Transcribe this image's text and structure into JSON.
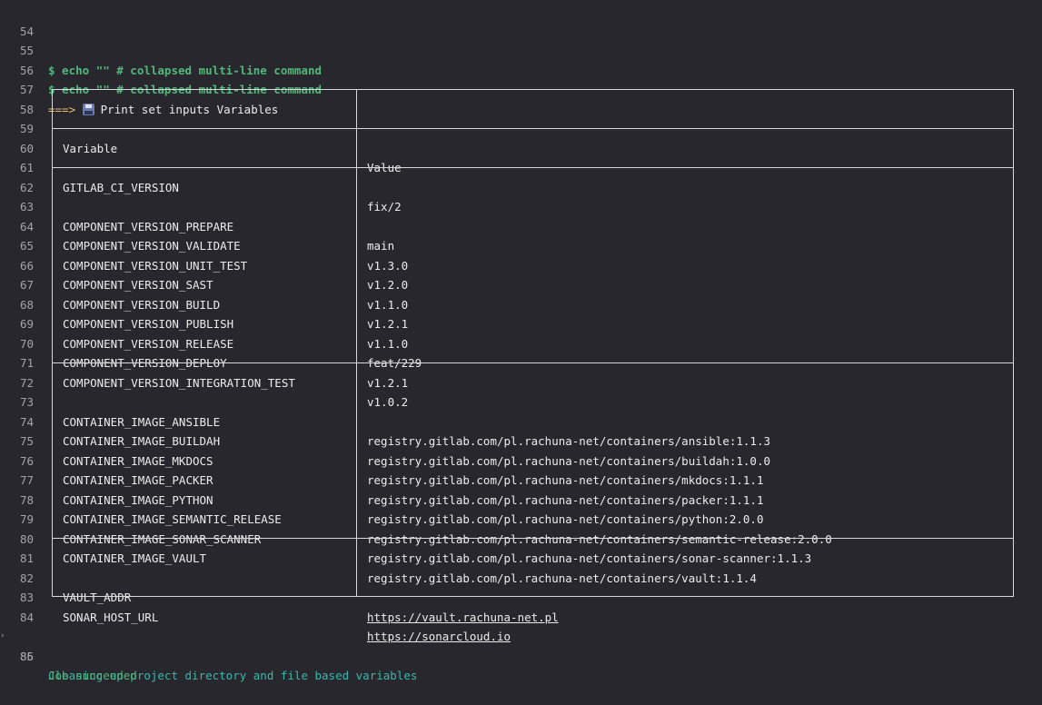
{
  "lines": [
    {
      "num": "54",
      "text": ""
    },
    {
      "num": "55",
      "text": "$ echo \"\" # collapsed multi-line command"
    },
    {
      "num": "56",
      "text": "$ echo \"\" # collapsed multi-line command"
    },
    {
      "num": "57",
      "arrow": "===>",
      "text": "Print set inputs Variables"
    },
    {
      "num": "58"
    },
    {
      "num": "59",
      "c1": "Variable",
      "c2": "Value"
    },
    {
      "num": "60"
    },
    {
      "num": "61",
      "c1": "GITLAB_CI_VERSION",
      "c2": "fix/2"
    },
    {
      "num": "62"
    },
    {
      "num": "63",
      "c1": "COMPONENT_VERSION_PREPARE",
      "c2": "main"
    },
    {
      "num": "64",
      "c1": "COMPONENT_VERSION_VALIDATE",
      "c2": "v1.3.0"
    },
    {
      "num": "65",
      "c1": "COMPONENT_VERSION_UNIT_TEST",
      "c2": "v1.2.0"
    },
    {
      "num": "66",
      "c1": "COMPONENT_VERSION_SAST",
      "c2": "v1.1.0"
    },
    {
      "num": "67",
      "c1": "COMPONENT_VERSION_BUILD",
      "c2": "v1.2.1"
    },
    {
      "num": "68",
      "c1": "COMPONENT_VERSION_PUBLISH",
      "c2": "v1.1.0"
    },
    {
      "num": "69",
      "c1": "COMPONENT_VERSION_RELEASE",
      "c2": "feat/229"
    },
    {
      "num": "70",
      "c1": "COMPONENT_VERSION_DEPLOY",
      "c2": "v1.2.1"
    },
    {
      "num": "71",
      "c1": "COMPONENT_VERSION_INTEGRATION_TEST",
      "c2": "v1.0.2"
    },
    {
      "num": "72"
    },
    {
      "num": "73",
      "c1": "CONTAINER_IMAGE_ANSIBLE",
      "c2": "registry.gitlab.com/pl.rachuna-net/containers/ansible:1.1.3"
    },
    {
      "num": "74",
      "c1": "CONTAINER_IMAGE_BUILDAH",
      "c2": "registry.gitlab.com/pl.rachuna-net/containers/buildah:1.0.0"
    },
    {
      "num": "75",
      "c1": "CONTAINER_IMAGE_MKDOCS",
      "c2": "registry.gitlab.com/pl.rachuna-net/containers/mkdocs:1.1.1"
    },
    {
      "num": "76",
      "c1": "CONTAINER_IMAGE_PACKER",
      "c2": "registry.gitlab.com/pl.rachuna-net/containers/packer:1.1.1"
    },
    {
      "num": "77",
      "c1": "CONTAINER_IMAGE_PYTHON",
      "c2": "registry.gitlab.com/pl.rachuna-net/containers/python:2.0.0"
    },
    {
      "num": "78",
      "c1": "CONTAINER_IMAGE_SEMANTIC_RELEASE",
      "c2": "registry.gitlab.com/pl.rachuna-net/containers/semantic-release:2.0.0"
    },
    {
      "num": "79",
      "c1": "CONTAINER_IMAGE_SONAR_SCANNER",
      "c2": "registry.gitlab.com/pl.rachuna-net/containers/sonar-scanner:1.1.3"
    },
    {
      "num": "80",
      "c1": "CONTAINER_IMAGE_VAULT",
      "c2": "registry.gitlab.com/pl.rachuna-net/containers/vault:1.1.4"
    },
    {
      "num": "81"
    },
    {
      "num": "82",
      "c1": "VAULT_ADDR",
      "c2": "https://vault.rachuna-net.pl"
    },
    {
      "num": "83",
      "c1": "SONAR_HOST_URL",
      "c2": "https://sonarcloud.io"
    },
    {
      "num": "84"
    },
    {
      "num": "85",
      "text": "Cleaning up project directory and file based variables"
    },
    {
      "num": "86",
      "text": "Job succeeded"
    }
  ],
  "colors": {
    "background": "#28272d",
    "command": "#52b87a",
    "section": "#35b8ad",
    "arrow": "#e9be74",
    "success": "#52b87a"
  },
  "icons": {
    "print_icon": "floppy-disk-icon",
    "section_caret": "caret-right-icon"
  }
}
